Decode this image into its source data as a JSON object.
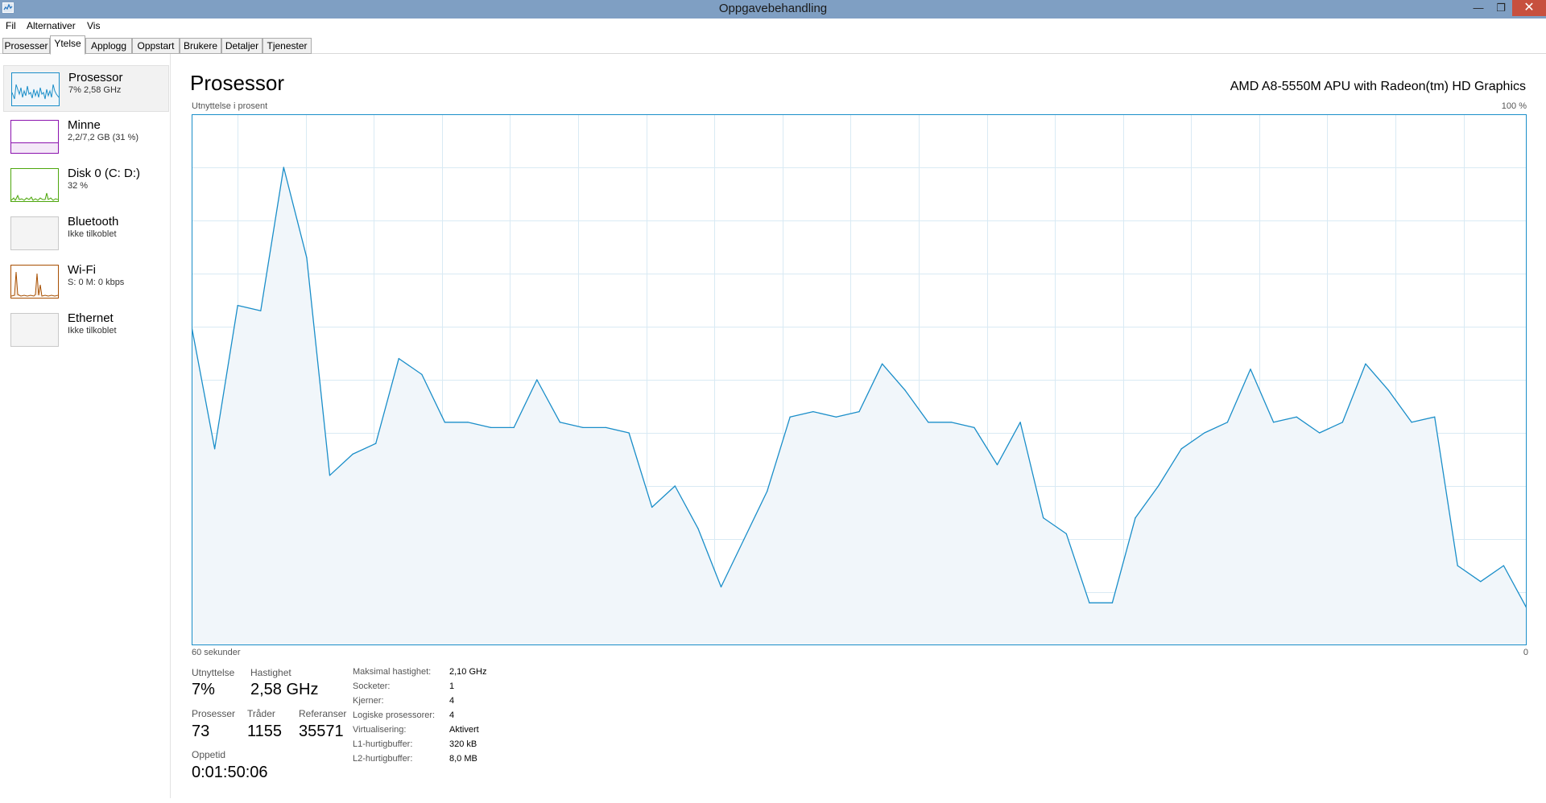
{
  "window": {
    "title": "Oppgavebehandling",
    "min_icon": "minimize-icon",
    "max_icon": "restore-icon",
    "close_icon": "close-icon"
  },
  "menu": [
    "Fil",
    "Alternativer",
    "Vis"
  ],
  "tabs": [
    "Prosesser",
    "Ytelse",
    "Applogg",
    "Oppstart",
    "Brukere",
    "Detaljer",
    "Tjenester"
  ],
  "active_tab": "Ytelse",
  "sidebar": [
    {
      "name": "Prosessor",
      "sub": "7% 2,58 GHz",
      "color": "#1a8ec9"
    },
    {
      "name": "Minne",
      "sub": "2,2/7,2 GB (31 %)",
      "color": "#8b12ae"
    },
    {
      "name": "Disk 0 (C: D:)",
      "sub": "32 %",
      "color": "#4da60c"
    },
    {
      "name": "Bluetooth",
      "sub": "Ikke tilkoblet",
      "color": "#c8c8c8"
    },
    {
      "name": "Wi-Fi",
      "sub": "S: 0 M: 0 kbps",
      "color": "#a74f01"
    },
    {
      "name": "Ethernet",
      "sub": "Ikke tilkoblet",
      "color": "#c8c8c8"
    }
  ],
  "main": {
    "title": "Prosessor",
    "cpu_name": "AMD A8-5550M APU with Radeon(tm) HD Graphics",
    "graph": {
      "ylabel": "Utnyttelse i prosent",
      "ymax_label": "100 %",
      "xleft_label": "60 sekunder",
      "xright_label": "0",
      "line_color": "#1a8ec9",
      "fill_color": "#f1f6fa",
      "grid_color": "#d9eaf4"
    }
  },
  "chart_data": {
    "type": "area",
    "ylim": [
      0,
      100
    ],
    "xlim": [
      60,
      0
    ],
    "x_direction": "seconds ago",
    "y": [
      60,
      37,
      64,
      63,
      90,
      73,
      32,
      36,
      38,
      54,
      51,
      42,
      42,
      41,
      41,
      50,
      42,
      41,
      41,
      40,
      26,
      30,
      22,
      11,
      20,
      29,
      43,
      44,
      43,
      44,
      53,
      48,
      42,
      42,
      41,
      34,
      42,
      24,
      21,
      8,
      8,
      24,
      30,
      37,
      40,
      42,
      52,
      42,
      43,
      40,
      42,
      53,
      48,
      42,
      43,
      15,
      12,
      15,
      7
    ]
  },
  "stats": {
    "utilization_label": "Utnyttelse",
    "utilization": "7%",
    "speed_label": "Hastighet",
    "speed": "2,58 GHz",
    "processes_label": "Prosesser",
    "processes": "73",
    "threads_label": "Tråder",
    "threads": "1155",
    "handles_label": "Referanser",
    "handles": "35571",
    "uptime_label": "Oppetid",
    "uptime": "0:01:50:06"
  },
  "details": [
    {
      "key": "Maksimal hastighet:",
      "value": "2,10 GHz"
    },
    {
      "key": "Socketer:",
      "value": "1"
    },
    {
      "key": "Kjerner:",
      "value": "4"
    },
    {
      "key": "Logiske prosessorer:",
      "value": "4"
    },
    {
      "key": "Virtualisering:",
      "value": "Aktivert"
    },
    {
      "key": "L1-hurtigbuffer:",
      "value": "320 kB"
    },
    {
      "key": "L2-hurtigbuffer:",
      "value": "8,0 MB"
    }
  ]
}
